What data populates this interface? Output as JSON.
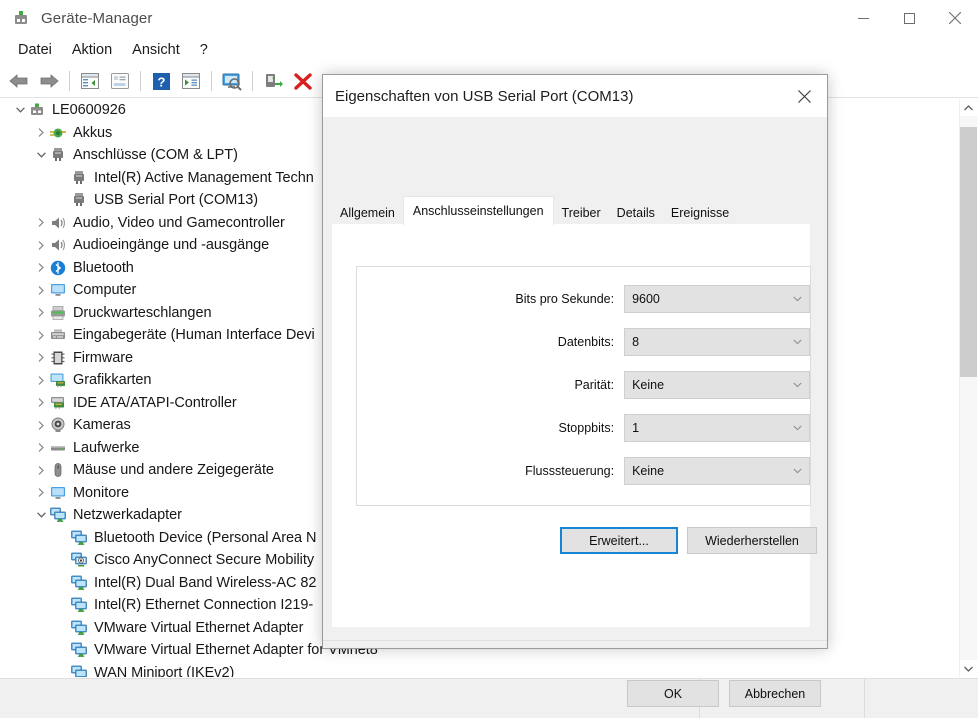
{
  "window": {
    "title": "Geräte-Manager",
    "icon": "device-manager-icon",
    "controls": {
      "minimize": "minimize-icon",
      "maximize": "maximize-icon",
      "close": "close-icon"
    }
  },
  "menubar": {
    "items": [
      "Datei",
      "Aktion",
      "Ansicht",
      "?"
    ]
  },
  "toolbar": {
    "buttons": [
      "back-arrow-icon",
      "forward-arrow-icon",
      "separator",
      "show-hidden-pane-icon",
      "properties-icon",
      "help-icon",
      "update-driver-icon",
      "scan-hardware-icon",
      "separator",
      "enable-device-icon",
      "uninstall-device-icon"
    ]
  },
  "tree": {
    "items": [
      {
        "label": "LE0600926",
        "indent": 0,
        "twisty": "expanded",
        "icon": "computer-root-icon"
      },
      {
        "label": "Akkus",
        "indent": 1,
        "twisty": "collapsed",
        "icon": "battery-icon"
      },
      {
        "label": "Anschlüsse (COM & LPT)",
        "indent": 1,
        "twisty": "expanded",
        "icon": "port-icon"
      },
      {
        "label": "Intel(R) Active Management Techn",
        "indent": 2,
        "twisty": "none",
        "icon": "port-icon"
      },
      {
        "label": "USB Serial Port (COM13)",
        "indent": 2,
        "twisty": "none",
        "icon": "port-icon"
      },
      {
        "label": "Audio, Video und Gamecontroller",
        "indent": 1,
        "twisty": "collapsed",
        "icon": "speaker-icon"
      },
      {
        "label": "Audioeingänge und -ausgänge",
        "indent": 1,
        "twisty": "collapsed",
        "icon": "speaker-icon"
      },
      {
        "label": "Bluetooth",
        "indent": 1,
        "twisty": "collapsed",
        "icon": "bluetooth-icon"
      },
      {
        "label": "Computer",
        "indent": 1,
        "twisty": "collapsed",
        "icon": "monitor-icon"
      },
      {
        "label": "Druckwarteschlangen",
        "indent": 1,
        "twisty": "collapsed",
        "icon": "printer-icon"
      },
      {
        "label": "Eingabegeräte (Human Interface Devi",
        "indent": 1,
        "twisty": "collapsed",
        "icon": "hid-icon"
      },
      {
        "label": "Firmware",
        "indent": 1,
        "twisty": "collapsed",
        "icon": "firmware-icon"
      },
      {
        "label": "Grafikkarten",
        "indent": 1,
        "twisty": "collapsed",
        "icon": "display-adapter-icon"
      },
      {
        "label": "IDE ATA/ATAPI-Controller",
        "indent": 1,
        "twisty": "collapsed",
        "icon": "ide-controller-icon"
      },
      {
        "label": "Kameras",
        "indent": 1,
        "twisty": "collapsed",
        "icon": "camera-icon"
      },
      {
        "label": "Laufwerke",
        "indent": 1,
        "twisty": "collapsed",
        "icon": "drive-icon"
      },
      {
        "label": "Mäuse und andere Zeigegeräte",
        "indent": 1,
        "twisty": "collapsed",
        "icon": "mouse-icon"
      },
      {
        "label": "Monitore",
        "indent": 1,
        "twisty": "collapsed",
        "icon": "monitor-icon"
      },
      {
        "label": "Netzwerkadapter",
        "indent": 1,
        "twisty": "expanded",
        "icon": "network-adapter-icon"
      },
      {
        "label": "Bluetooth Device (Personal Area N",
        "indent": 2,
        "twisty": "none",
        "icon": "network-adapter-icon"
      },
      {
        "label": "Cisco AnyConnect Secure Mobility",
        "indent": 2,
        "twisty": "none",
        "icon": "network-adapter-vpn-icon"
      },
      {
        "label": "Intel(R) Dual Band Wireless-AC 82",
        "indent": 2,
        "twisty": "none",
        "icon": "network-adapter-icon"
      },
      {
        "label": "Intel(R) Ethernet Connection I219-",
        "indent": 2,
        "twisty": "none",
        "icon": "network-adapter-icon"
      },
      {
        "label": "VMware Virtual Ethernet Adapter",
        "indent": 2,
        "twisty": "none",
        "icon": "network-adapter-icon"
      },
      {
        "label": "VMware Virtual Ethernet Adapter for VMnet8",
        "indent": 2,
        "twisty": "none",
        "icon": "network-adapter-icon"
      },
      {
        "label": "WAN Miniport (IKEv2)",
        "indent": 2,
        "twisty": "none",
        "icon": "network-adapter-icon"
      }
    ]
  },
  "scrollbar": {
    "up": "scroll-up-icon",
    "down": "scroll-down-icon"
  },
  "dialog": {
    "title": "Eigenschaften von USB Serial Port (COM13)",
    "close": "close-icon",
    "tabs": [
      {
        "label": "Allgemein",
        "selected": false
      },
      {
        "label": "Anschlusseinstellungen",
        "selected": true
      },
      {
        "label": "Treiber",
        "selected": false
      },
      {
        "label": "Details",
        "selected": false
      },
      {
        "label": "Ereignisse",
        "selected": false
      }
    ],
    "fields": [
      {
        "label": "Bits pro Sekunde:",
        "value": "9600"
      },
      {
        "label": "Datenbits:",
        "value": "8"
      },
      {
        "label": "Parität:",
        "value": "Keine"
      },
      {
        "label": "Stoppbits:",
        "value": "1"
      },
      {
        "label": "Flusssteuerung:",
        "value": "Keine"
      }
    ],
    "buttons": {
      "advanced": "Erweitert...",
      "restore": "Wiederherstellen",
      "ok": "OK",
      "cancel": "Abbrechen"
    },
    "focus_color": "#1686d4"
  }
}
